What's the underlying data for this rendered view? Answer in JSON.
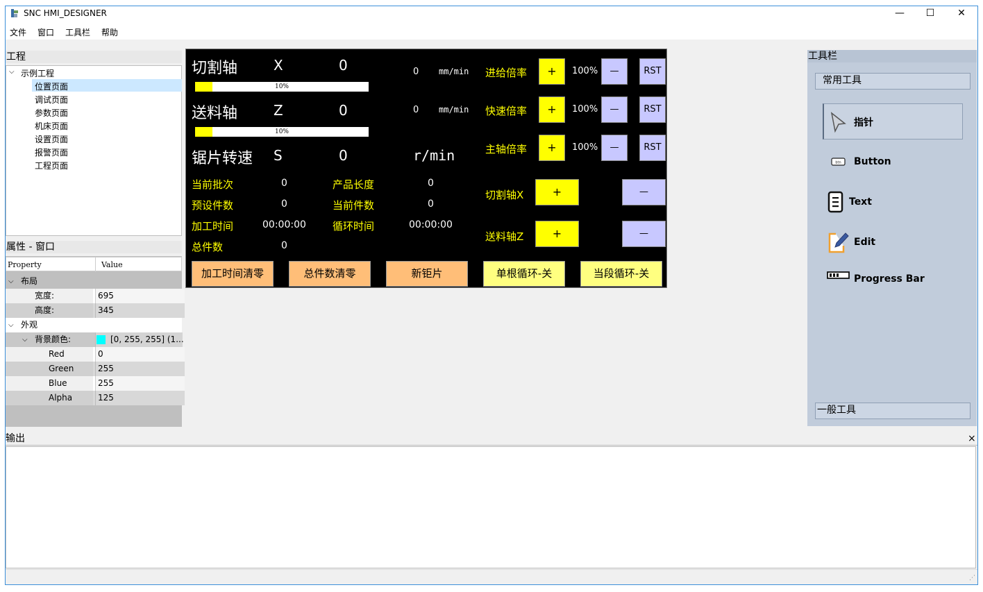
{
  "window": {
    "title": "SNC HMI_DESIGNER",
    "min": "—",
    "max": "☐",
    "close": "✕"
  },
  "menu": [
    "文件",
    "窗口",
    "工具栏",
    "帮助"
  ],
  "project": {
    "title": "工程",
    "root": "示例工程",
    "pages": [
      "位置页面",
      "调试页面",
      "参数页面",
      "机床页面",
      "设置页面",
      "报警页面",
      "工程页面"
    ]
  },
  "properties": {
    "title": "属性 - 窗口",
    "headers": [
      "Property",
      "Value"
    ],
    "group_layout": "布局",
    "width_label": "宽度:",
    "width": "695",
    "height_label": "高度:",
    "height": "345",
    "group_appearance": "外观",
    "bg_label": "背景颜色:",
    "bg_value": "[0, 255, 255] (1...",
    "bg_swatch": "#00ffff",
    "red_label": "Red",
    "red": "0",
    "green_label": "Green",
    "green": "255",
    "blue_label": "Blue",
    "blue": "255",
    "alpha_label": "Alpha",
    "alpha": "125"
  },
  "hmi": {
    "axis1": {
      "name": "切割轴",
      "letter": "X",
      "pos": "0",
      "bar": "10%",
      "bar_level": 0.1,
      "speed": "0",
      "unit": "mm/min"
    },
    "axis2": {
      "name": "送料轴",
      "letter": "Z",
      "pos": "0",
      "bar": "10%",
      "bar_level": 0.1,
      "speed": "0",
      "unit": "mm/min"
    },
    "spindle": {
      "name": "锯片转速",
      "letter": "S",
      "value": "0",
      "unit": "r/min"
    },
    "rates": [
      {
        "label": "进给倍率",
        "plus": "+",
        "pct": "100%",
        "minus": "—",
        "rst": "RST"
      },
      {
        "label": "快速倍率",
        "plus": "+",
        "pct": "100%",
        "minus": "—",
        "rst": "RST"
      },
      {
        "label": "主轴倍率",
        "plus": "+",
        "pct": "100%",
        "minus": "—",
        "rst": "RST"
      }
    ],
    "stats": {
      "batch_label": "当前批次",
      "batch": "0",
      "length_label": "产品长度",
      "length": "0",
      "preset_label": "预设件数",
      "preset": "0",
      "current_label": "当前件数",
      "current": "0",
      "proc_label": "加工时间",
      "proc": "00:00:00",
      "cycle_label": "循环时间",
      "cycle": "00:00:00",
      "total_label": "总件数",
      "total": "0"
    },
    "jog": [
      {
        "label": "切割轴X",
        "plus": "+",
        "minus": "—"
      },
      {
        "label": "送料轴Z",
        "plus": "+",
        "minus": "—"
      }
    ],
    "buttons": [
      "加工时间清零",
      "总件数清零",
      "新钜片",
      "单根循环-关",
      "当段循环-关"
    ]
  },
  "toolbox": {
    "title": "工具栏",
    "common": "常用工具",
    "general": "一般工具",
    "tools": [
      "指针",
      "Button",
      "Text",
      "Edit",
      "Progress Bar"
    ]
  },
  "output": {
    "title": "输出",
    "close": "×"
  }
}
